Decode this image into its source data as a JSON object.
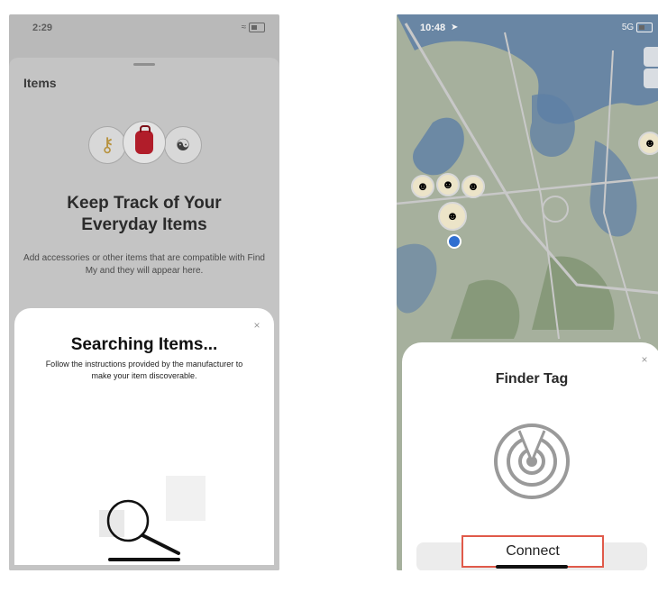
{
  "left_screen": {
    "status_time": "2:29",
    "items_title": "Items",
    "heading_line1": "Keep Track of Your",
    "heading_line2": "Everyday Items",
    "description": "Add accessories or other items that are compatible with Find My and they will appear here.",
    "searching_title": "Searching Items...",
    "searching_desc": "Follow the instructions provided by the manufacturer to make your item discoverable.",
    "close_glyph": "×"
  },
  "right_screen": {
    "status_time": "10:48",
    "status_network": "5G",
    "tag_title": "Finder Tag",
    "connect_label": "Connect",
    "close_glyph": "×"
  },
  "colors": {
    "connect_highlight": "#e05a4a",
    "bag": "#b11d2a",
    "map_water": "#5e7fa6",
    "map_land": "#a9b2a3"
  },
  "icons": [
    "key-icon",
    "backpack-icon",
    "bicycle-icon",
    "magnifier-icon",
    "radar-icon",
    "location-arrow-icon",
    "wifi-icon",
    "battery-icon"
  ]
}
